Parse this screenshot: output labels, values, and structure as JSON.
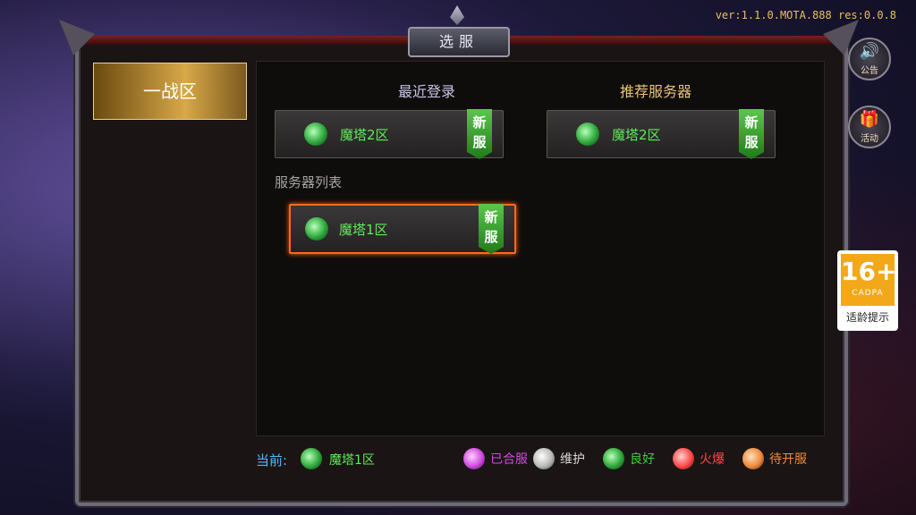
{
  "version_text": "ver:1.1.0.MOTA.888 res:0.0.8",
  "title": "选服",
  "sidebar": {
    "zone_label": "一战区"
  },
  "sections": {
    "recent": "最近登录",
    "recommended": "推荐服务器",
    "list": "服务器列表"
  },
  "servers": {
    "recent": {
      "name": "魔塔2区",
      "tag": "新服"
    },
    "recommended": {
      "name": "魔塔2区",
      "tag": "新服"
    },
    "list": [
      {
        "name": "魔塔1区",
        "tag": "新服"
      }
    ]
  },
  "current": {
    "label": "当前:",
    "name": "魔塔1区"
  },
  "legend": [
    {
      "text": "已合服",
      "color": "#d04ae0"
    },
    {
      "text": "维护",
      "color": "#d8d8d8"
    },
    {
      "text": "良好",
      "color": "#3ecf3a"
    },
    {
      "text": "火爆",
      "color": "#ff4848"
    },
    {
      "text": "待开服",
      "color": "#f08a3a"
    }
  ],
  "side_buttons": {
    "announcement": "公告",
    "activity": "活动"
  },
  "age_rating": {
    "number": "16+",
    "org": "CADPA",
    "caption": "适龄提示"
  },
  "icons": {
    "dragon": "dragon-icon",
    "speaker": "speaker-icon",
    "gift": "gift-icon"
  }
}
